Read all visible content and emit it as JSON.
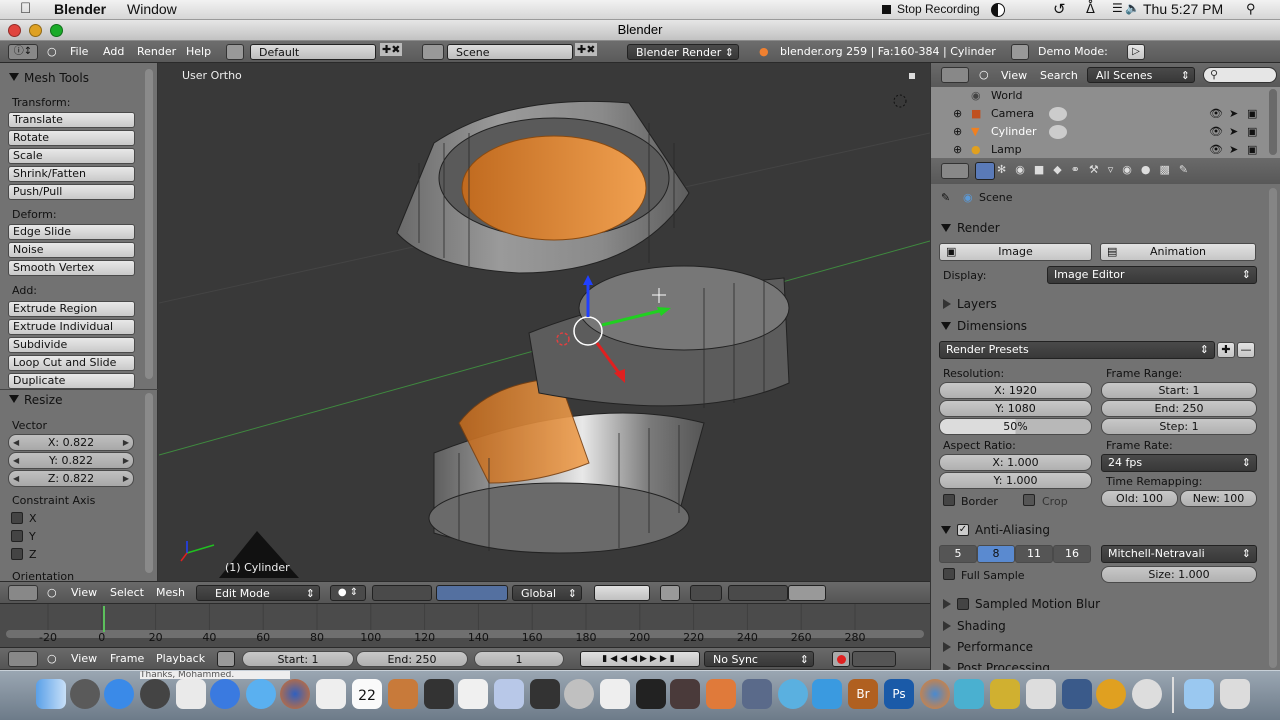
{
  "menubar": {
    "app": "Blender",
    "window": "Window",
    "recording": "Stop Recording",
    "clock": "Thu 5:27 PM"
  },
  "titlebar": {
    "title": "Blender"
  },
  "info_header": {
    "menus": [
      "File",
      "Add",
      "Render",
      "Help"
    ],
    "screen": "Default",
    "scene": "Scene",
    "engine": "Blender Render",
    "stats": "blender.org 259 | Fa:160-384 | Cylinder",
    "demo": "Demo Mode:"
  },
  "tool_shelf": {
    "title": "Mesh Tools",
    "transform_label": "Transform:",
    "transform": [
      "Translate",
      "Rotate",
      "Scale",
      "Shrink/Fatten",
      "Push/Pull"
    ],
    "deform_label": "Deform:",
    "deform": [
      "Edge Slide",
      "Noise",
      "Smooth Vertex"
    ],
    "add_label": "Add:",
    "add": [
      "Extrude Region",
      "Extrude Individual",
      "Subdivide",
      "Loop Cut and Slide",
      "Duplicate"
    ],
    "resize_title": "Resize",
    "vector_label": "Vector",
    "vector": [
      "X: 0.822",
      "Y: 0.822",
      "Z: 0.822"
    ],
    "constraint_label": "Constraint Axis",
    "axes": [
      "X",
      "Y",
      "Z"
    ],
    "orientation_label": "Orientation"
  },
  "viewport": {
    "view_label": "User Ortho",
    "object_label": "(1) Cylinder"
  },
  "viewport_header": {
    "menus": [
      "View",
      "Select",
      "Mesh"
    ],
    "mode": "Edit Mode",
    "orientation": "Global"
  },
  "timeline": {
    "ticks": [
      "-20",
      "0",
      "20",
      "40",
      "60",
      "80",
      "100",
      "120",
      "140",
      "160",
      "180",
      "200",
      "220",
      "240",
      "260",
      "280"
    ],
    "current_frame": 1
  },
  "timeline_header": {
    "menus": [
      "View",
      "Frame",
      "Playback"
    ],
    "start": "Start: 1",
    "end": "End: 250",
    "frame": "1",
    "sync": "No Sync"
  },
  "outliner": {
    "menus": [
      "View",
      "Search"
    ],
    "filter": "All Scenes",
    "items": [
      "World",
      "Camera",
      "Cylinder",
      "Lamp"
    ]
  },
  "properties": {
    "scene": "Scene",
    "render_title": "Render",
    "image_btn": "Image",
    "animation_btn": "Animation",
    "display_label": "Display:",
    "display_value": "Image Editor",
    "layers": "Layers",
    "dimensions": "Dimensions",
    "render_presets": "Render Presets",
    "resolution_label": "Resolution:",
    "res_x": "X: 1920",
    "res_y": "Y: 1080",
    "res_pct": "50%",
    "frame_range_label": "Frame Range:",
    "frame_start": "Start: 1",
    "frame_end": "End: 250",
    "frame_step": "Step: 1",
    "aspect_label": "Aspect Ratio:",
    "aspect_x": "X: 1.000",
    "aspect_y": "Y: 1.000",
    "frame_rate_label": "Frame Rate:",
    "frame_rate": "24 fps",
    "border": "Border",
    "crop": "Crop",
    "time_remap_label": "Time Remapping:",
    "old": "Old: 100",
    "new": "New: 100",
    "aa_title": "Anti-Aliasing",
    "aa_samples": [
      "5",
      "8",
      "11",
      "16"
    ],
    "aa_filter": "Mitchell-Netravali",
    "full_sample": "Full Sample",
    "size": "Size: 1.000",
    "motion_blur": "Sampled Motion Blur",
    "shading": "Shading",
    "performance": "Performance",
    "post_processing": "Post Processing"
  },
  "dock": {
    "calendar_day": "22",
    "notice": "Thanks, Mohammed."
  }
}
